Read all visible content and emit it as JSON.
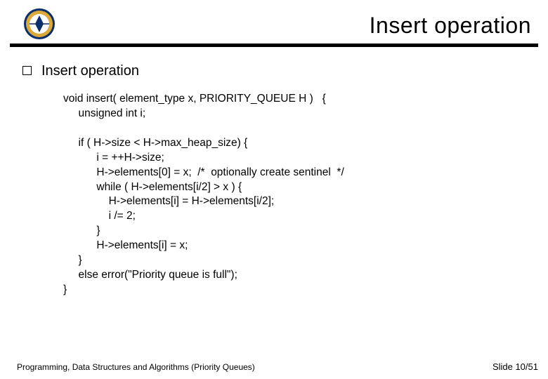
{
  "header": {
    "title": "Insert operation"
  },
  "bullet": {
    "label": "Insert operation"
  },
  "code": {
    "l01": "void insert( element_type x, PRIORITY_QUEUE H )   {",
    "l02": "     unsigned int i;",
    "l03": "",
    "l04": "     if ( H->size < H->max_heap_size) {",
    "l05": "           i = ++H->size;",
    "l06": "           H->elements[0] = x;  /*  optionally create sentinel  */",
    "l07": "           while ( H->elements[i/2] > x ) {",
    "l08": "               H->elements[i] = H->elements[i/2];",
    "l09": "               i /= 2;",
    "l10": "           }",
    "l11": "           H->elements[i] = x;",
    "l12": "     }",
    "l13": "     else error(\"Priority queue is full\");",
    "l14": "}"
  },
  "footer": {
    "course": "Programming, Data Structures and Algorithms  (Priority Queues)",
    "page": "Slide 10/51"
  }
}
